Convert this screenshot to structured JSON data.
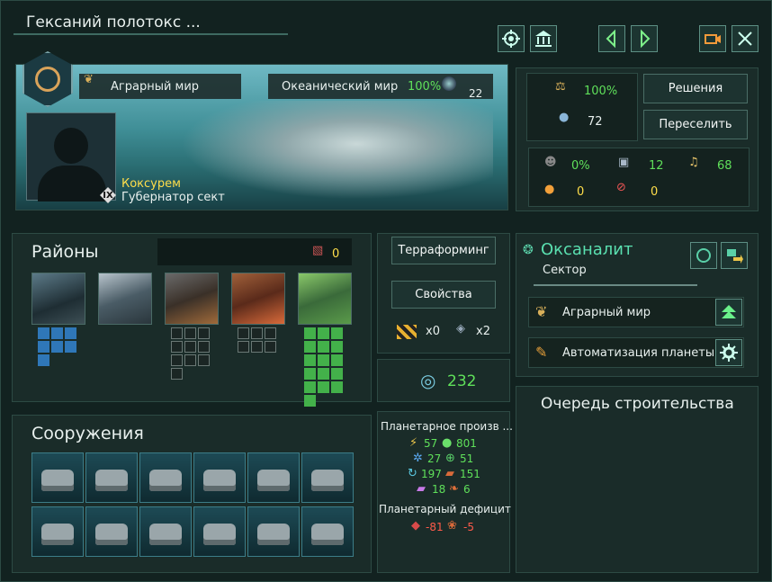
{
  "window": {
    "title": "Гексаний полотокс ..."
  },
  "icons": [
    "target-icon",
    "bank-icon",
    "arrow-left-icon",
    "arrow-right-icon",
    "camera-icon",
    "close-icon"
  ],
  "banner": {
    "planet_class": "Аграрный мир",
    "planet_type": "Океанический мир",
    "habitability": "100%",
    "size": "22",
    "governor_name": "Коксурем",
    "governor_title": "Губернатор сект",
    "governor_level": "IX"
  },
  "stats": {
    "stability": "100%",
    "pops": "72",
    "crime": "0%",
    "jobs": "12",
    "amenities": "68",
    "unemployed": "0",
    "housing_free": "0",
    "decisions_label": "Решения",
    "resettle_label": "Переселить"
  },
  "districts": {
    "title": "Районы",
    "free_slots": "0",
    "terraform_label": "Терраформинг",
    "properties_label": "Свойства",
    "mod1_count": "x0",
    "mod2_count": "x2",
    "energy_total": "232"
  },
  "buildings": {
    "title": "Сооружения"
  },
  "production": {
    "title": "Планетарное произв ...",
    "energy": "57",
    "food": "801",
    "research": "27",
    "trade": "51",
    "consumer_goods": "197",
    "minerals": "151",
    "alloys": "18",
    "unity": "6",
    "deficit_title": "Планетарный дефицит",
    "deficit_1": "-81",
    "deficit_2": "-5"
  },
  "sector": {
    "name": "Оксаналит",
    "subtitle": "Сектор",
    "designation": "Аграрный мир",
    "automation": "Автоматизация планеты"
  },
  "queue": {
    "title": "Очередь строительства"
  },
  "colors": {
    "accent": "#5fe05a",
    "negative": "#ff5a4a",
    "panel": "#1a2c29"
  }
}
